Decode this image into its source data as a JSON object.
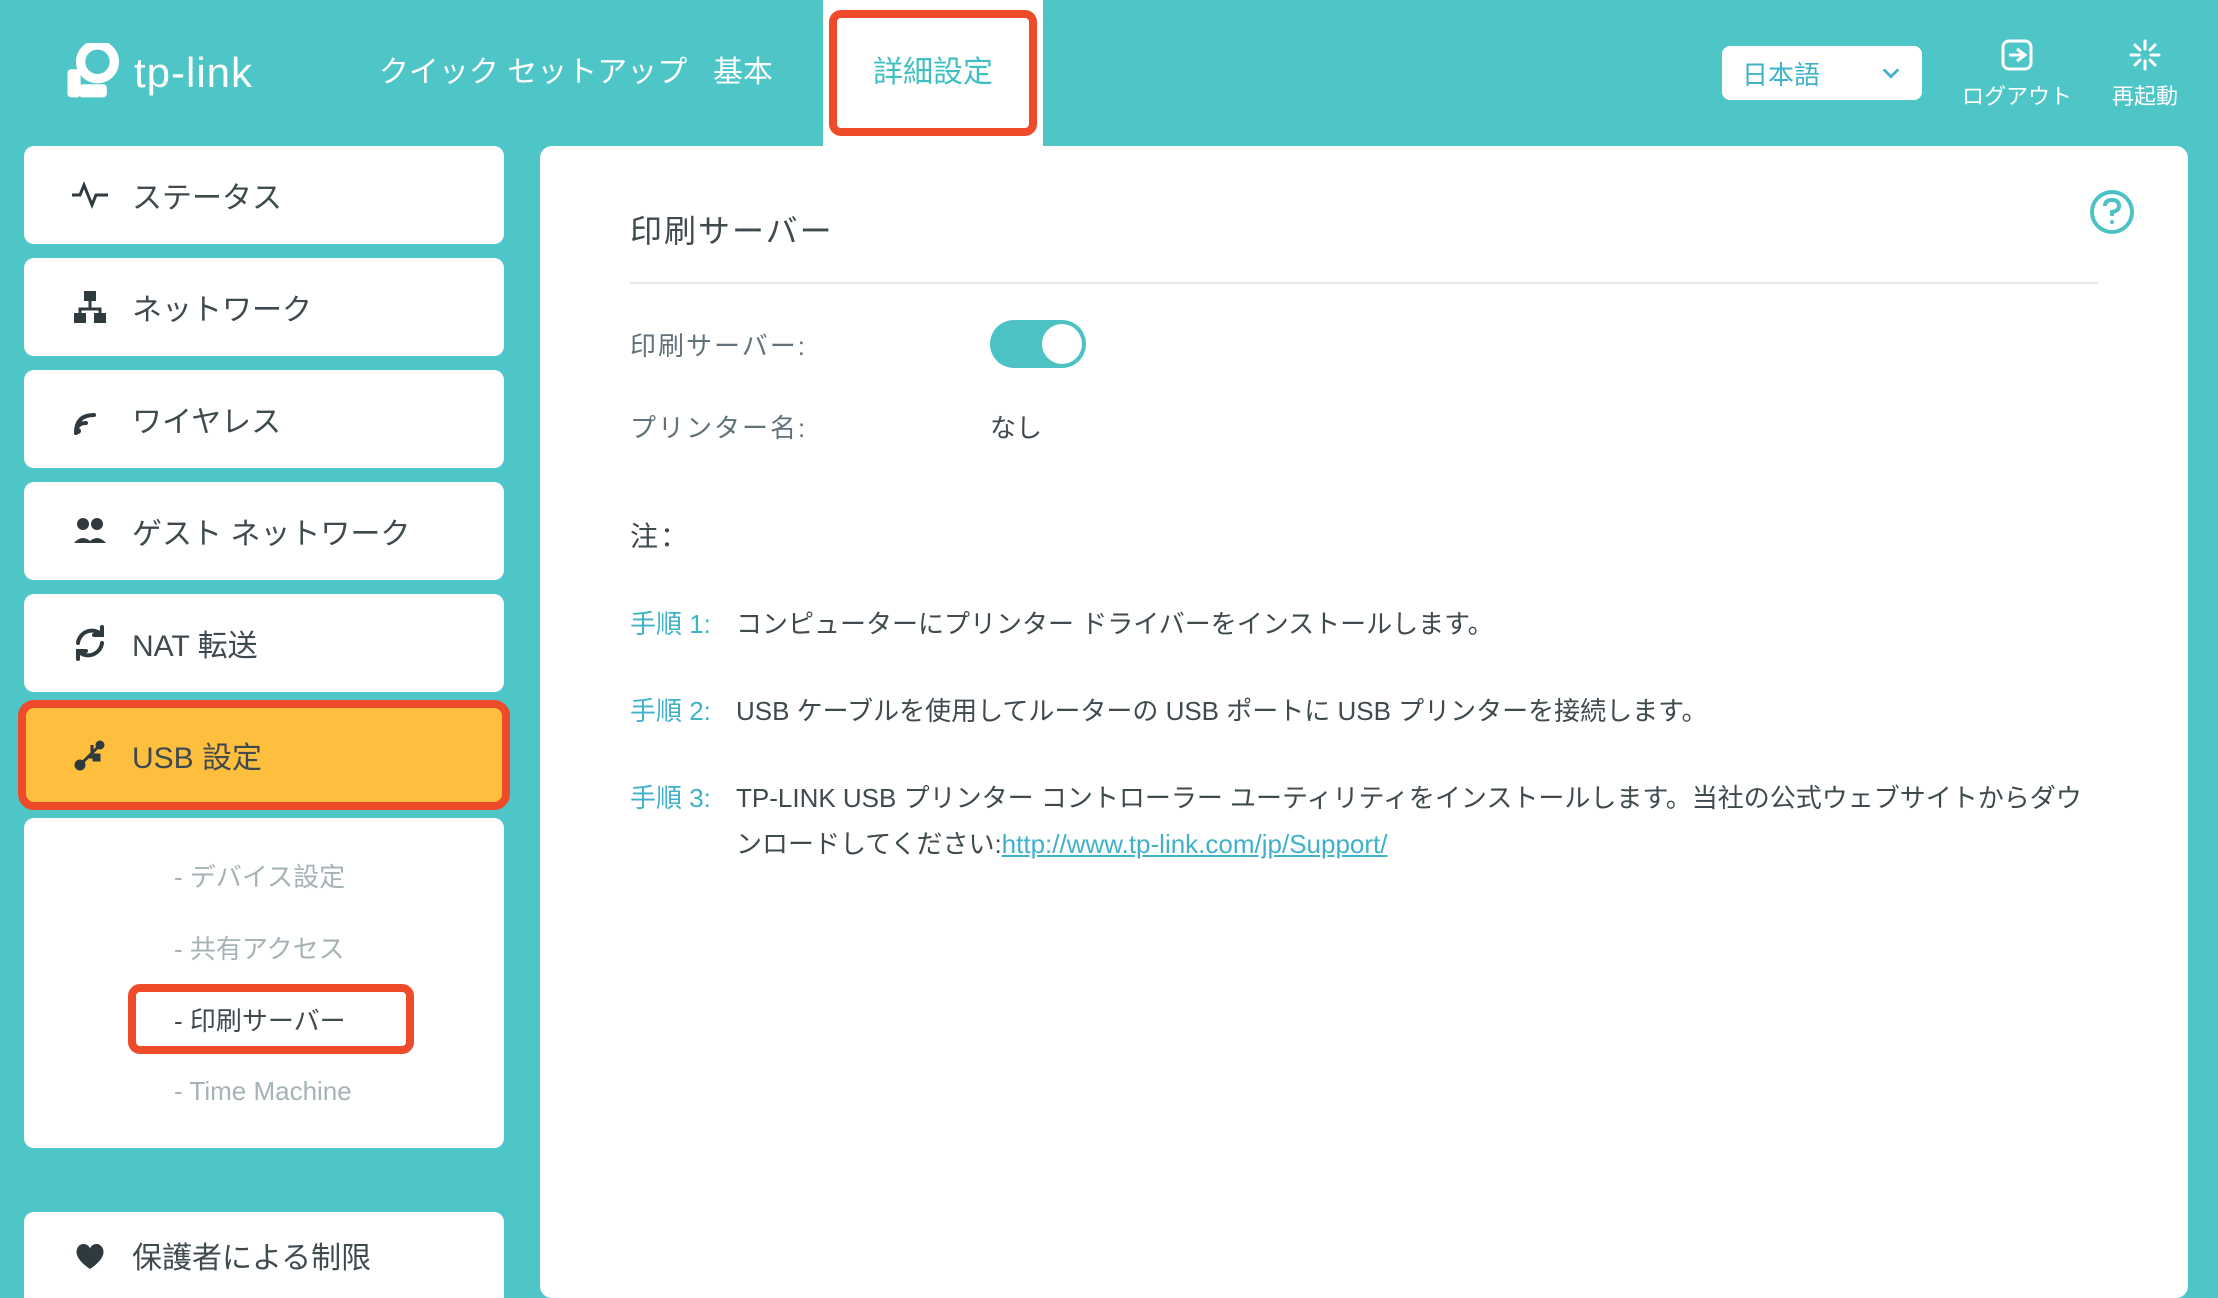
{
  "brand": "tp-link",
  "tabs": {
    "quick_setup": "クイック セットアップ",
    "basic": "基本",
    "advanced": "詳細設定"
  },
  "header": {
    "language": "日本語",
    "logout": "ログアウト",
    "reboot": "再起動"
  },
  "sidebar": {
    "status": "ステータス",
    "network": "ネットワーク",
    "wireless": "ワイヤレス",
    "guest_network": "ゲスト ネットワーク",
    "nat_forwarding": "NAT 転送",
    "usb_settings": "USB 設定",
    "usb_sub": {
      "device_settings": "-  デバイス設定",
      "shared_access": "-  共有アクセス",
      "print_server": "-  印刷サーバー",
      "time_machine": "-  Time Machine"
    },
    "parental_controls": "保護者による制限"
  },
  "main": {
    "section_title": "印刷サーバー",
    "print_server_label": "印刷サーバー:",
    "printer_name_label": "プリンター名:",
    "printer_name_value": "なし",
    "note_label": "注：",
    "step1_num": "手順 1:",
    "step1_text": "コンピューターにプリンター ドライバーをインストールします。",
    "step2_num": "手順 2:",
    "step2_text": "USB ケーブルを使用してルーターの USB ポートに USB プリンターを接続します。",
    "step3_num": "手順 3:",
    "step3_text_a": "TP-LINK USB プリンター コントローラー ユーティリティをインストールします。当社の公式ウェブサイトからダウンロードしてください:",
    "step3_link": "http://www.tp-link.com/jp/Support/"
  }
}
